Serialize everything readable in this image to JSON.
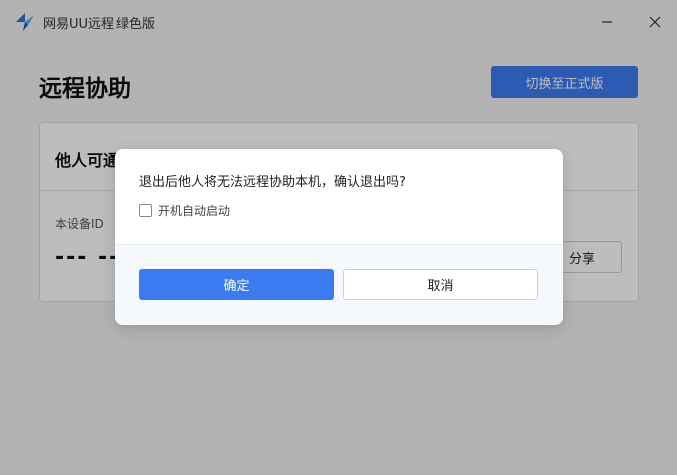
{
  "window": {
    "app_name": "网易UU远程",
    "edition": "绿色版",
    "logo_icon": "uu-logo-icon",
    "minimize_icon": "minimize-icon",
    "close_icon": "close-icon"
  },
  "main": {
    "title": "远程协助",
    "switch_button": "切换至正式版",
    "card": {
      "title_visible": "他人可通",
      "device_id_label": "本设备ID",
      "device_id_value": "--- ---",
      "share_button_visible": "分享"
    }
  },
  "dialog": {
    "message": "退出后他人将无法远程协助本机，确认退出吗?",
    "checkbox_label": "开机自动启动",
    "checkbox_checked": false,
    "confirm_label": "确定",
    "cancel_label": "取消"
  },
  "colors": {
    "accent": "#3b7bf2",
    "overlay": "rgba(0,0,0,0.26)"
  }
}
